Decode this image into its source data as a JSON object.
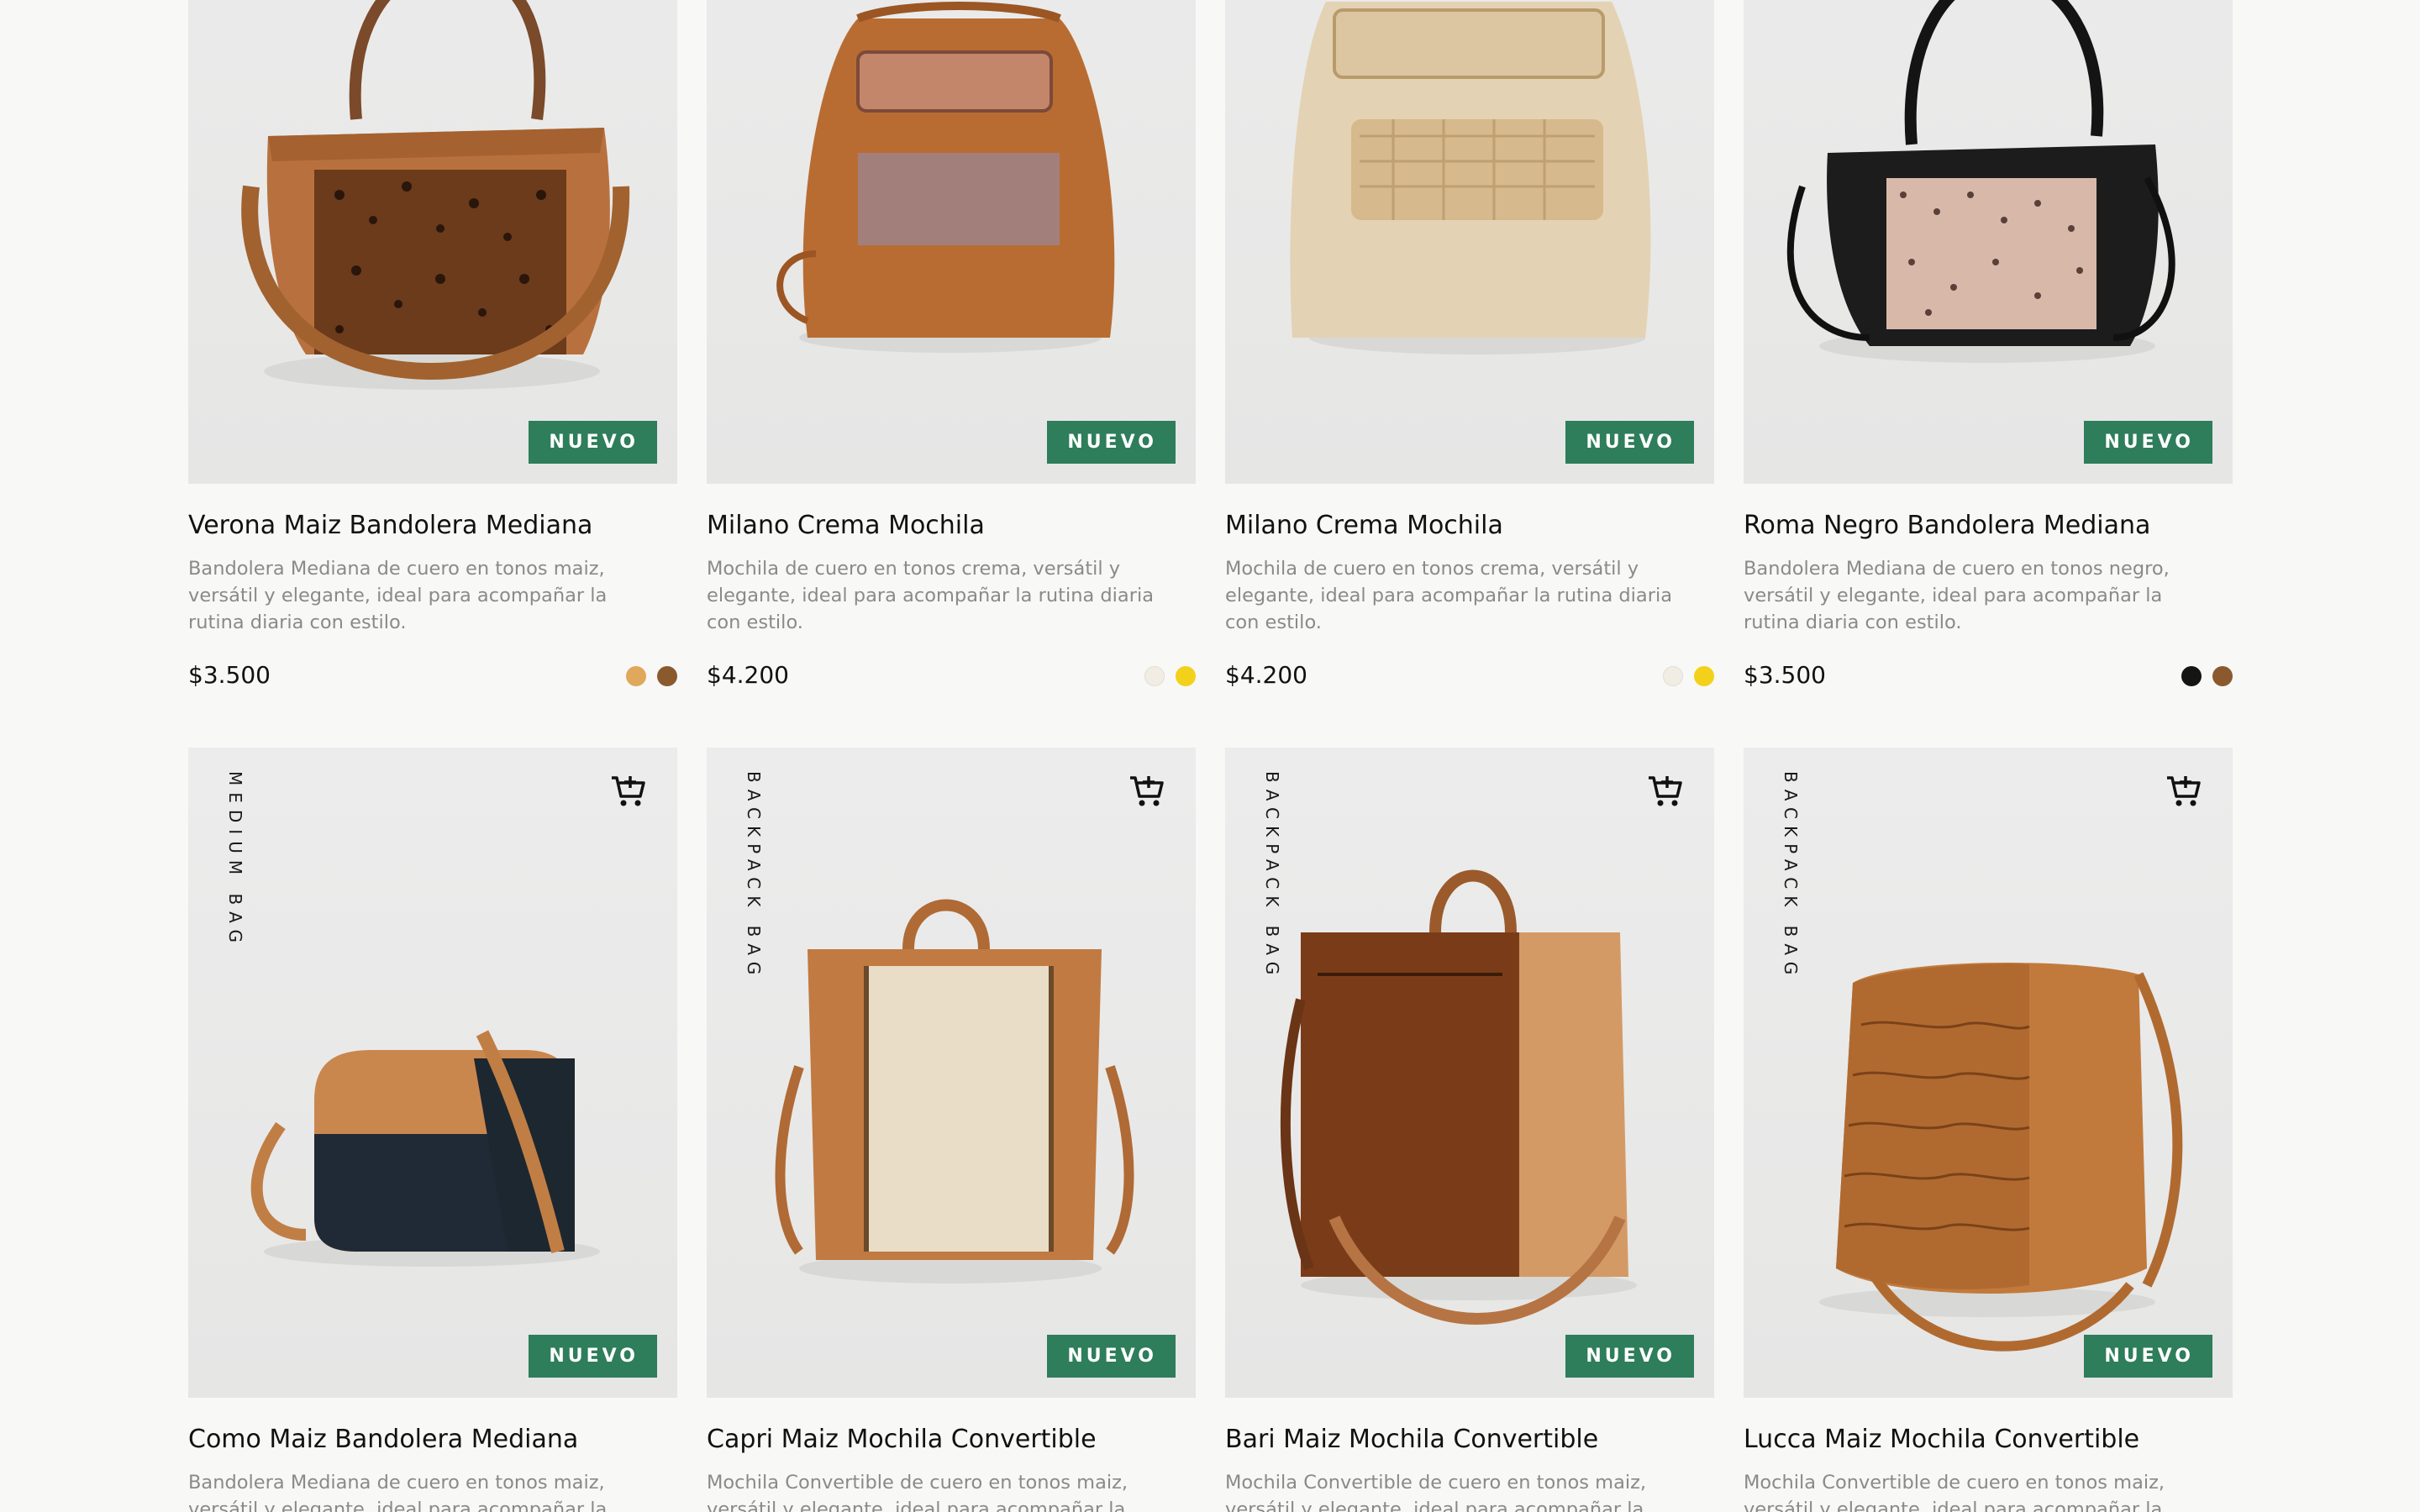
{
  "products": [
    {
      "title": "Verona Maiz Bandolera Mediana",
      "description": "Bandolera Mediana de cuero en tonos maiz, versátil y elegante, ideal para acompañar la rutina diaria con estilo.",
      "price": "$3.500",
      "badge": "NUEVO",
      "category": "",
      "swatches": [
        "#e0a85a",
        "#8a5a2e"
      ]
    },
    {
      "title": "Milano Crema Mochila",
      "description": "Mochila de cuero en tonos crema, versátil y elegante, ideal para acompañar la rutina diaria con estilo.",
      "price": "$4.200",
      "badge": "NUEVO",
      "category": "",
      "swatches": [
        "#f2ede4",
        "#f3d11a"
      ]
    },
    {
      "title": "Milano Crema Mochila",
      "description": "Mochila de cuero en tonos crema, versátil y elegante, ideal para acompañar la rutina diaria con estilo.",
      "price": "$4.200",
      "badge": "NUEVO",
      "category": "",
      "swatches": [
        "#f2ede4",
        "#f3d11a"
      ]
    },
    {
      "title": "Roma Negro Bandolera Mediana",
      "description": "Bandolera Mediana de cuero en tonos negro, versátil y elegante, ideal para acompañar la rutina diaria con estilo.",
      "price": "$3.500",
      "badge": "NUEVO",
      "category": "",
      "swatches": [
        "#151515",
        "#8a5a2e"
      ]
    },
    {
      "title": "Como Maiz Bandolera Mediana",
      "description": "Bandolera Mediana de cuero en tonos maiz, versátil y elegante, ideal para acompañar la",
      "badge": "NUEVO",
      "category": "MEDIUM BAG"
    },
    {
      "title": "Capri Maiz Mochila Convertible",
      "description": "Mochila Convertible de cuero en tonos maiz, versátil y elegante, ideal para acompañar la",
      "badge": "NUEVO",
      "category": "BACKPACK BAG"
    },
    {
      "title": "Bari Maiz Mochila Convertible",
      "description": "Mochila Convertible de cuero en tonos maiz, versátil y elegante, ideal para acompañar la",
      "badge": "NUEVO",
      "category": "BACKPACK BAG"
    },
    {
      "title": "Lucca Maiz Mochila Convertible",
      "description": "Mochila Convertible de cuero en tonos maiz, versátil y elegante, ideal para acompañar la",
      "badge": "NUEVO",
      "category": "BACKPACK BAG"
    }
  ],
  "icons": {
    "cart": "add-to-cart-icon"
  },
  "colors": {
    "badge_bg": "#2e7d5b",
    "card_bg": "#ececec",
    "page_bg": "#f8f8f7"
  }
}
